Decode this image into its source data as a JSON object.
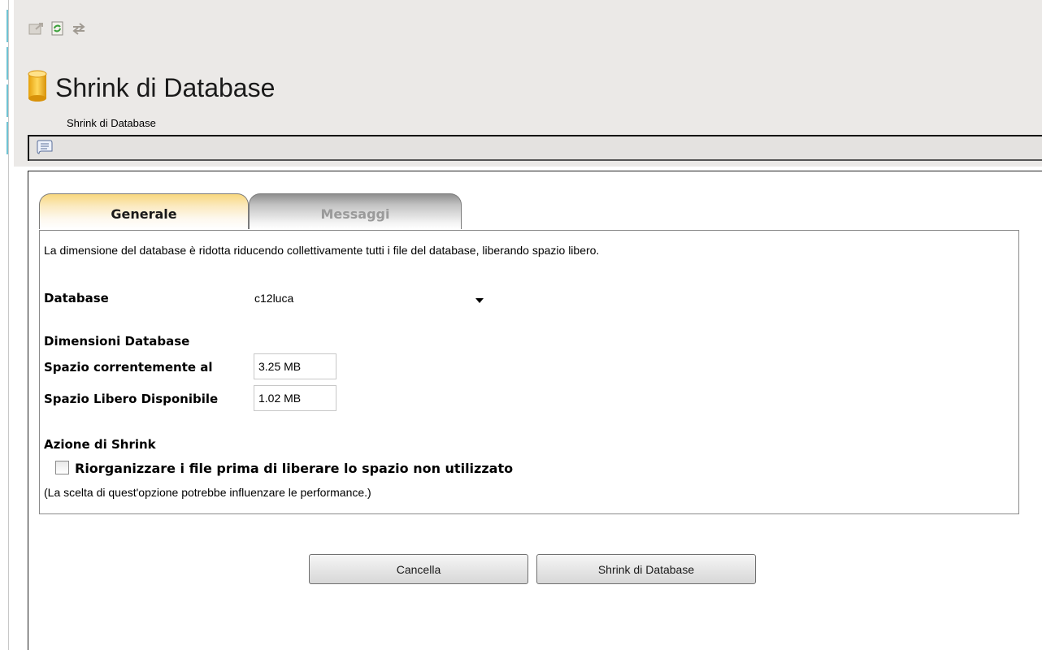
{
  "header": {
    "title": "Shrink di Database",
    "subtitle": "Shrink di Database",
    "toolbar_icons": [
      "export-icon",
      "refresh-icon",
      "sync-icon"
    ],
    "subtoolbar_icon": "script-icon"
  },
  "tabs": [
    {
      "label": "Generale",
      "active": true
    },
    {
      "label": "Messaggi",
      "active": false
    }
  ],
  "form": {
    "description": "La dimensione del database è ridotta riducendo collettivamente tutti i file del database, liberando spazio libero.",
    "database_label": "Database",
    "database_value": "c12luca",
    "dimensions_heading": "Dimensioni Database",
    "current_space_label": "Spazio correntemente al",
    "current_space_value": "3.25 MB",
    "free_space_label": "Spazio Libero Disponibile",
    "free_space_value": "1.02 MB",
    "shrink_action_heading": "Azione di Shrink",
    "reorganize_label": "Riorganizzare i file prima di liberare lo spazio non utilizzato",
    "reorganize_checked": false,
    "note": "(La scelta di quest'opzione potrebbe influenzare le performance.)"
  },
  "buttons": {
    "cancel_label": "Cancella",
    "shrink_label": "Shrink di Database"
  },
  "colors": {
    "active_tab": "#f8d77e",
    "header_bg": "#ebe9e7",
    "db_icon": "#f0b419"
  }
}
